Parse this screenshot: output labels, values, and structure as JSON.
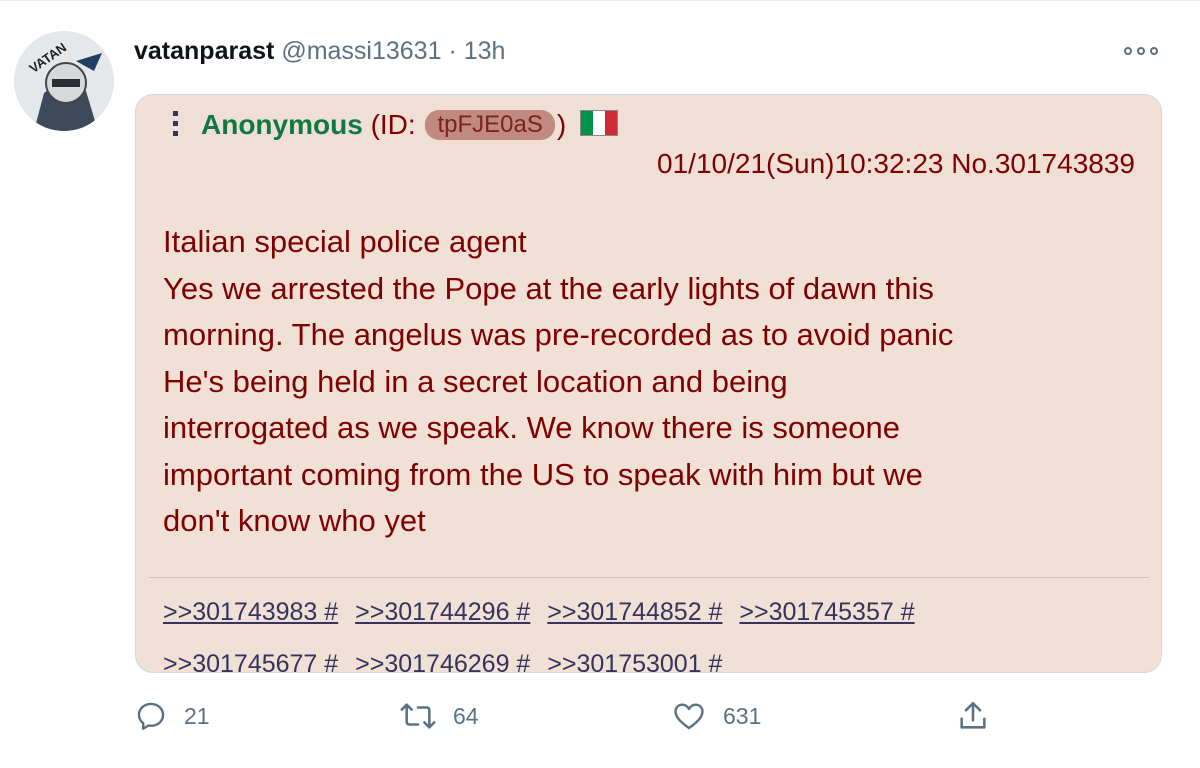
{
  "tweet": {
    "display_name": "vatanparast",
    "handle": "@massi13631",
    "separator": "·",
    "time": "13h",
    "avatar_text": "VATAN"
  },
  "post": {
    "poster": "Anonymous",
    "id_prefix": "(ID:",
    "id_value": "tpFJE0aS",
    "id_suffix": ")",
    "flag": {
      "colors": [
        "#009246",
        "#ffffff",
        "#ce2b37"
      ]
    },
    "datetime": "01/10/21(Sun)10:32:23 No.301743839",
    "lines": [
      "Italian special police agent",
      "Yes we arrested the Pope at the early lights of dawn this",
      "morning. The angelus was pre-recorded as to avoid panic",
      "He's being held in a secret location and being",
      "interrogated as we speak. We know there is someone",
      "important coming from the US to speak with him but we",
      "don't know who yet"
    ],
    "replies_row1": [
      ">>301743983 #",
      ">>301744296 #",
      ">>301744852 #",
      ">>301745357 #"
    ],
    "replies_row2": [
      ">>301745677 #",
      ">>301746269 #",
      ">>301753001 #"
    ]
  },
  "actions": {
    "reply_count": "21",
    "retweet_count": "64",
    "like_count": "631"
  },
  "colors": {
    "post_bg": "#f0e0d6",
    "post_text": "#800000",
    "anon_name": "#117743",
    "reply_link": "#34345c",
    "muted": "#5b7083"
  }
}
